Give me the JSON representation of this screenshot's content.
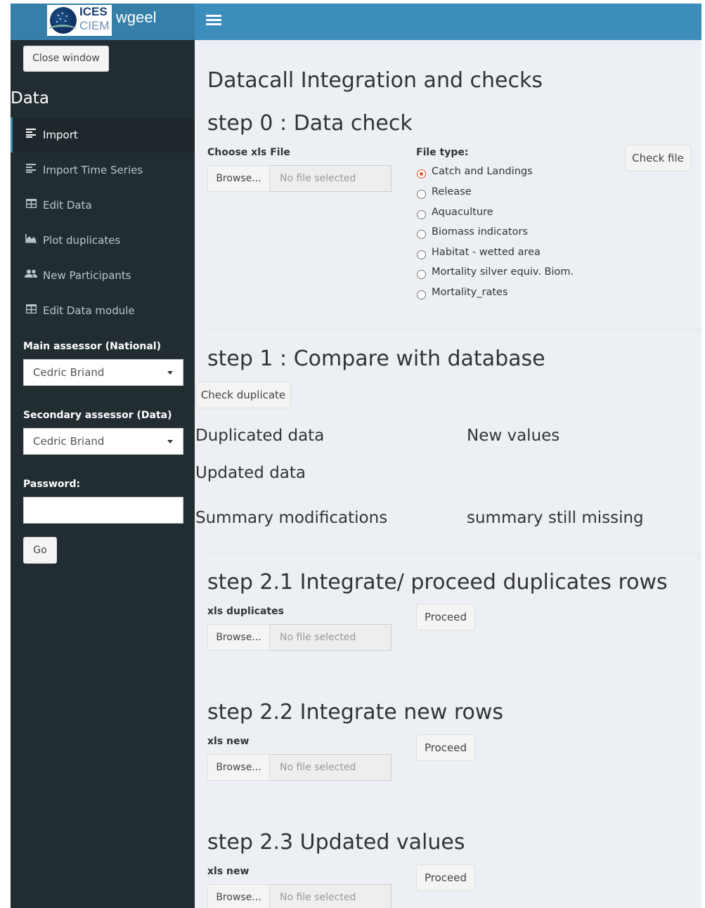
{
  "header": {
    "logo_text_top": "ICES",
    "logo_text_bottom": "CIEM",
    "app_name": "wgeel",
    "menu_toggle_icon": "hamburger-icon"
  },
  "sidebar": {
    "close_button": "Close window",
    "section_title": "Data",
    "items": [
      {
        "label": "Import",
        "icon": "align-left-icon",
        "active": true
      },
      {
        "label": "Import Time Series",
        "icon": "align-left-icon",
        "active": false
      },
      {
        "label": "Edit Data",
        "icon": "table-icon",
        "active": false
      },
      {
        "label": "Plot duplicates",
        "icon": "area-chart-icon",
        "active": false
      },
      {
        "label": "New Participants",
        "icon": "users-icon",
        "active": false
      },
      {
        "label": "Edit Data module",
        "icon": "table-icon",
        "active": false
      }
    ],
    "main_assessor": {
      "label": "Main assessor (National)",
      "value": "Cedric Briand"
    },
    "secondary_assessor": {
      "label": "Secondary assessor (Data)",
      "value": "Cedric Briand"
    },
    "password": {
      "label": "Password:",
      "value": ""
    },
    "go_button": "Go"
  },
  "main": {
    "title": "Datacall Integration and checks",
    "step0": {
      "heading": "step 0 : Data check",
      "file_label": "Choose xls File",
      "browse": "Browse...",
      "file_placeholder": "No file selected",
      "file_type_label": "File type:",
      "file_types": [
        {
          "label": "Catch and Landings",
          "selected": true
        },
        {
          "label": "Release",
          "selected": false
        },
        {
          "label": "Aquaculture",
          "selected": false
        },
        {
          "label": "Biomass indicators",
          "selected": false
        },
        {
          "label": "Habitat - wetted area",
          "selected": false
        },
        {
          "label": "Mortality silver equiv. Biom.",
          "selected": false
        },
        {
          "label": "Mortality_rates",
          "selected": false
        }
      ],
      "check_button": "Check file"
    },
    "step1": {
      "heading": "step 1 : Compare with database",
      "check_button": "Check duplicate",
      "duplicated_data": "Duplicated data",
      "new_values": "New values",
      "updated_data": "Updated data",
      "summary_modifications": "Summary modifications",
      "summary_missing": "summary still missing"
    },
    "step21": {
      "heading": "step 2.1 Integrate/ proceed duplicates rows",
      "file_label": "xls duplicates",
      "browse": "Browse...",
      "file_placeholder": "No file selected",
      "proceed": "Proceed"
    },
    "step22": {
      "heading": "step 2.2 Integrate new rows",
      "file_label": "xls new",
      "browse": "Browse...",
      "file_placeholder": "No file selected",
      "proceed": "Proceed"
    },
    "step23": {
      "heading": "step 2.3 Updated values",
      "file_label": "xls new",
      "browse": "Browse...",
      "file_placeholder": "No file selected",
      "proceed": "Proceed"
    }
  },
  "colors": {
    "header_logo_bg": "#367fa9",
    "navbar_bg": "#3c8dbc",
    "sidebar_bg": "#222d32",
    "content_bg": "#ecf0f5",
    "radio_selected": "#e8502a"
  }
}
